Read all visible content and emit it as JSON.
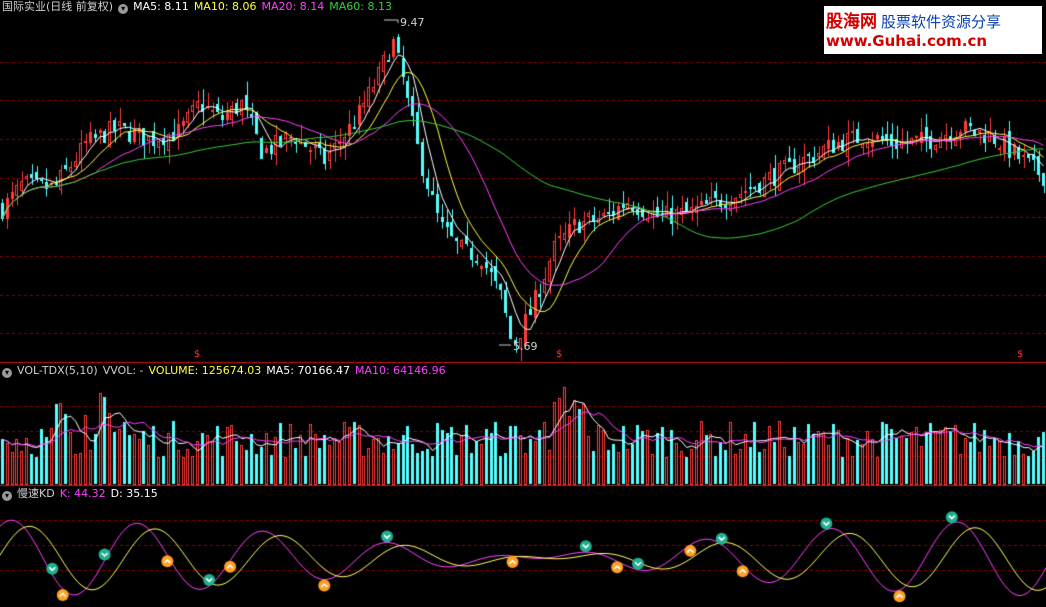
{
  "price_header": {
    "title": "国际实业(日线 前复权)",
    "ma5": "MA5: 8.11",
    "ma10": "MA10: 8.06",
    "ma20": "MA20: 8.14",
    "ma60": "MA60: 8.13"
  },
  "vol_header": {
    "title": "VOL-TDX(5,10)",
    "vvol": "VVOL: -",
    "volume": "VOLUME: 125674.03",
    "ma5": "MA5: 70166.47",
    "ma10": "MA10: 64146.96"
  },
  "kd_header": {
    "title": "慢速KD",
    "k": "K: 44.32",
    "d": "D: 35.15"
  },
  "annotations": {
    "high": "9.47",
    "low": "5.69",
    "marker": "$"
  },
  "watermark": {
    "brand": "股海网",
    "slogan": "股票软件资源分享",
    "url": "www.Guhai.com.cn"
  },
  "icons": {
    "panel_toggle": "circle-down-icon",
    "buy_signal": "orange-up-arrow-icon",
    "sell_signal": "teal-down-arrow-icon"
  },
  "colors": {
    "up": "#ff3b3b",
    "down": "#54ffff",
    "ma5": "#ffffff",
    "ma10": "#ffff40",
    "ma20": "#ff40ff",
    "ma60": "#38d038",
    "grid": "#8b0000"
  },
  "chart_data": {
    "type": "candlestick",
    "ylim": [
      5.5,
      9.8
    ],
    "marker_positions": [
      0.19,
      0.535,
      0.975
    ],
    "price_path": [
      [
        0,
        7.4
      ],
      [
        0.02,
        7.7
      ],
      [
        0.05,
        7.65
      ],
      [
        0.08,
        8.2
      ],
      [
        0.11,
        8.4
      ],
      [
        0.14,
        8.25
      ],
      [
        0.17,
        8.35
      ],
      [
        0.19,
        8.7
      ],
      [
        0.21,
        8.5
      ],
      [
        0.23,
        8.7
      ],
      [
        0.25,
        8.1
      ],
      [
        0.28,
        8.3
      ],
      [
        0.31,
        8.0
      ],
      [
        0.34,
        8.5
      ],
      [
        0.36,
        9.0
      ],
      [
        0.375,
        9.47
      ],
      [
        0.385,
        9.0
      ],
      [
        0.4,
        8.1
      ],
      [
        0.42,
        7.2
      ],
      [
        0.44,
        6.9
      ],
      [
        0.46,
        6.8
      ],
      [
        0.48,
        6.3
      ],
      [
        0.49,
        5.69
      ],
      [
        0.51,
        6.2
      ],
      [
        0.53,
        6.9
      ],
      [
        0.55,
        7.2
      ],
      [
        0.58,
        7.3
      ],
      [
        0.6,
        7.5
      ],
      [
        0.63,
        7.3
      ],
      [
        0.66,
        7.35
      ],
      [
        0.69,
        7.5
      ],
      [
        0.71,
        7.6
      ],
      [
        0.74,
        7.8
      ],
      [
        0.77,
        8.0
      ],
      [
        0.8,
        8.2
      ],
      [
        0.83,
        8.3
      ],
      [
        0.86,
        8.2
      ],
      [
        0.89,
        8.25
      ],
      [
        0.92,
        8.4
      ],
      [
        0.95,
        8.3
      ],
      [
        0.98,
        8.0
      ],
      [
        1.0,
        7.8
      ]
    ],
    "kd_buy_signals": [
      0.06,
      0.16,
      0.22,
      0.31,
      0.49,
      0.59,
      0.66,
      0.71,
      0.86
    ],
    "kd_sell_signals": [
      0.05,
      0.1,
      0.2,
      0.37,
      0.56,
      0.61,
      0.69,
      0.79,
      0.91
    ]
  }
}
